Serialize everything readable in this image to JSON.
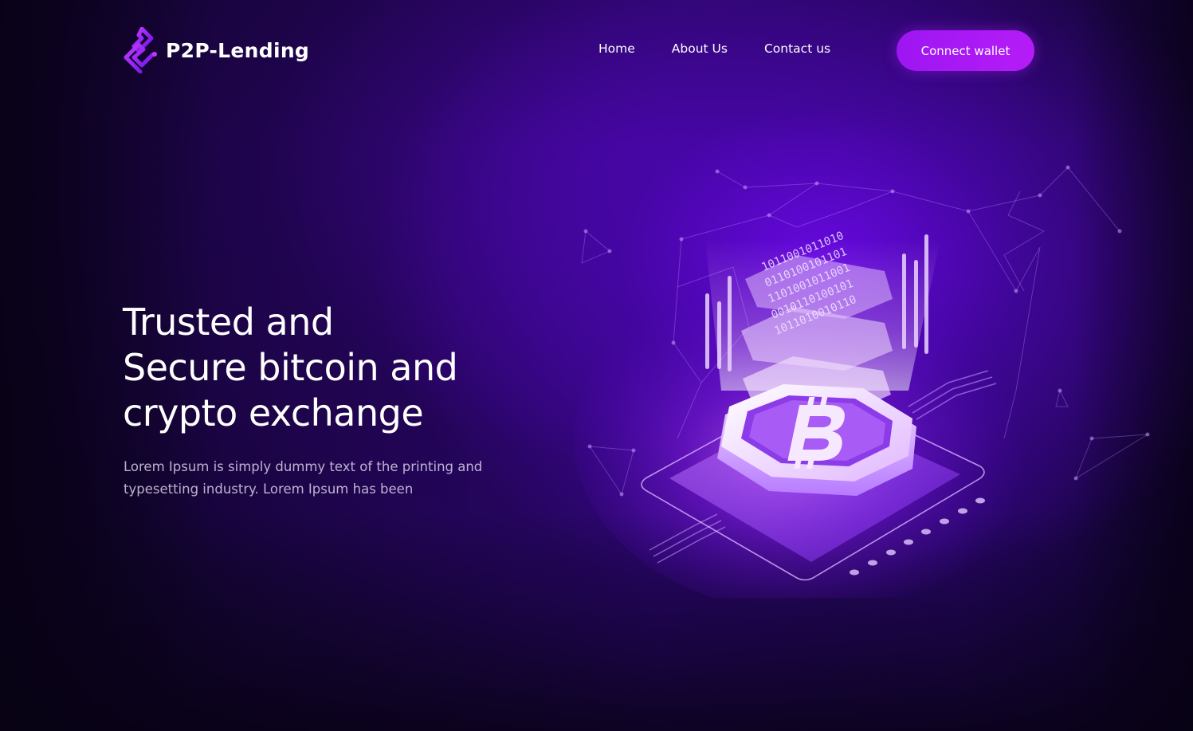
{
  "brand": {
    "name": "P2P-Lending",
    "accent": "#a818f5",
    "logo_icon": "chain-link-logo-icon"
  },
  "nav": {
    "items": [
      {
        "label": "Home"
      },
      {
        "label": "About Us"
      },
      {
        "label": "Contact us"
      }
    ],
    "cta_label": "Connect wallet"
  },
  "hero": {
    "title_lines": [
      "Trusted and",
      "Secure bitcoin and",
      "crypto exchange"
    ],
    "description_lines": [
      "Lorem Ipsum is simply dummy text of the printing and",
      "typesetting industry. Lorem Ipsum has been"
    ],
    "illustration_icon": "bitcoin-block-illustration-icon",
    "binary_digits": "1011001011010"
  },
  "colors": {
    "background_dark": "#0a0318",
    "background_purple": "#4a08b0",
    "button_gradient": "#b51cf7"
  }
}
